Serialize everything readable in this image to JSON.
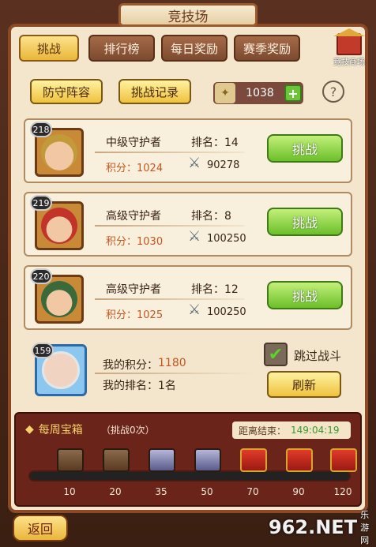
{
  "title": "竞技场",
  "tabs": [
    {
      "label": "挑战",
      "active": true
    },
    {
      "label": "排行榜",
      "active": false
    },
    {
      "label": "每日奖励",
      "active": false
    },
    {
      "label": "赛季奖励",
      "active": false
    }
  ],
  "shop": {
    "label": "竞技商场"
  },
  "actions": {
    "defense_label": "防守阵容",
    "record_label": "挑战记录"
  },
  "currency": {
    "value": "1038",
    "plus": "+"
  },
  "help": "?",
  "opponents": [
    {
      "level": "218",
      "name": "中级守护者",
      "rank_label": "排名：14",
      "score_label": "积分：1024",
      "power": "90278",
      "button": "挑战"
    },
    {
      "level": "219",
      "name": "高级守护者",
      "rank_label": "排名：8",
      "score_label": "积分：1030",
      "power": "100250",
      "button": "挑战"
    },
    {
      "level": "220",
      "name": "高级守护者",
      "rank_label": "排名：12",
      "score_label": "积分：1025",
      "power": "100250",
      "button": "挑战"
    }
  ],
  "me": {
    "level": "159",
    "score_label": "我的积分：",
    "score_value": "1180",
    "rank_label": "我的排名：",
    "rank_value": "1名"
  },
  "skip_battle": {
    "label": "跳过战斗",
    "checked": true
  },
  "refresh_label": "刷新",
  "weekly": {
    "title": "每周宝箱",
    "subtitle": "（挑战0次）",
    "countdown_label": "距离结束：",
    "countdown_value": "149:04:19",
    "progress": 0,
    "milestones": [
      "10",
      "20",
      "35",
      "50",
      "70",
      "90",
      "120"
    ]
  },
  "back_label": "返回",
  "watermark": {
    "logo": "962.NET",
    "text": "乐游网"
  }
}
